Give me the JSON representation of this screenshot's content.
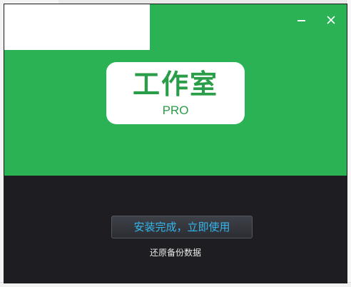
{
  "window": {
    "background_color": "#1e1e22",
    "header_color": "#2ab255",
    "minimize_icon": "minimize-icon",
    "close_icon": "close-icon"
  },
  "logo": {
    "title": "工作室",
    "subtitle": "PRO",
    "text_color": "#2a9d48"
  },
  "actions": {
    "primary_label": "安装完成，立即使用",
    "primary_text_color": "#33b6ee",
    "secondary_label": "还原备份数据"
  }
}
